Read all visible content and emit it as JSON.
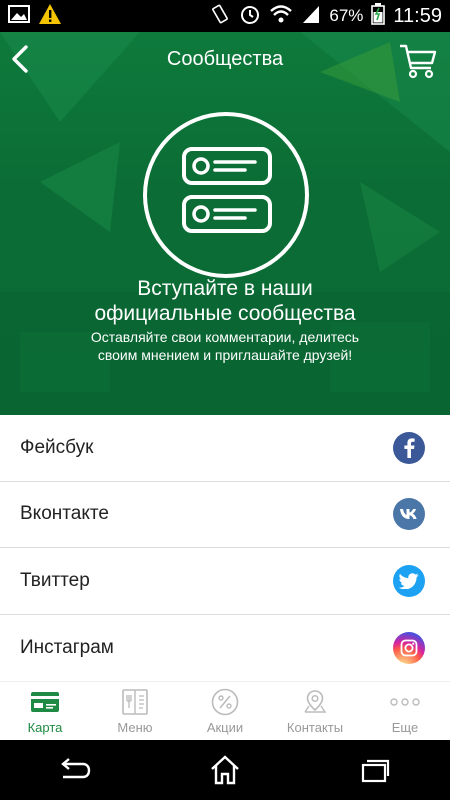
{
  "status_bar": {
    "battery": "67%",
    "time": "11:59"
  },
  "header": {
    "title": "Сообщества"
  },
  "hero": {
    "heading_line1": "Вступайте в наши",
    "heading_line2": "официальные сообщества",
    "sub_line1": "Оставляйте свои комментарии, делитесь",
    "sub_line2": "своим мнением и приглашайте друзей!"
  },
  "communities": [
    {
      "label": "Фейсбук",
      "icon": "facebook-icon",
      "color": "#3b5998"
    },
    {
      "label": "Вконтакте",
      "icon": "vk-icon",
      "color": "#4a76a8"
    },
    {
      "label": "Твиттер",
      "icon": "twitter-icon",
      "color": "#1da1f2"
    },
    {
      "label": "Инстаграм",
      "icon": "instagram-icon",
      "color": "#d6249f"
    }
  ],
  "tabs": [
    {
      "label": "Карта",
      "icon": "card-icon",
      "active": true
    },
    {
      "label": "Меню",
      "icon": "menu-book-icon",
      "active": false
    },
    {
      "label": "Акции",
      "icon": "percent-icon",
      "active": false
    },
    {
      "label": "Контакты",
      "icon": "location-pin-icon",
      "active": false
    },
    {
      "label": "Еще",
      "icon": "more-icon",
      "active": false
    }
  ],
  "colors": {
    "brand_green": "#0b6d35",
    "active_tab": "#1f8a43",
    "inactive_tab": "#999999"
  }
}
